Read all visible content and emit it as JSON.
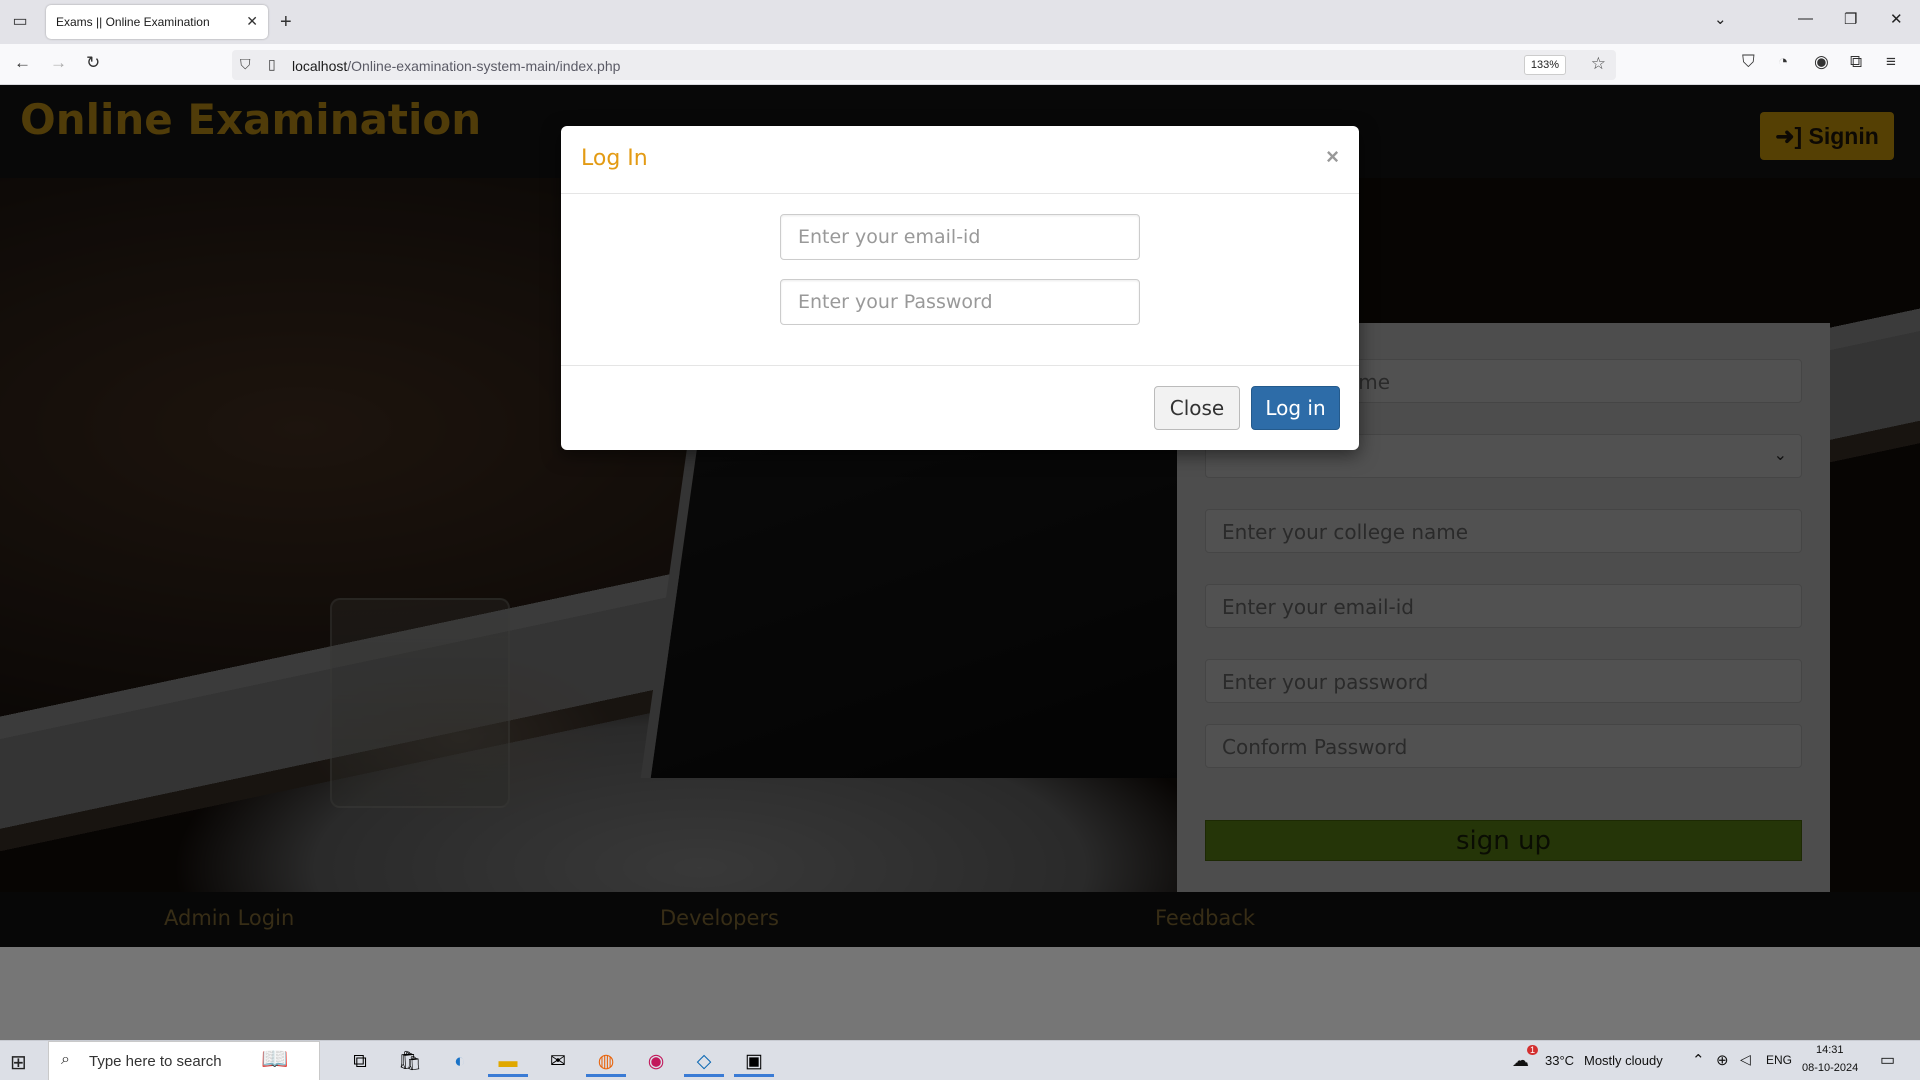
{
  "browser": {
    "tab_title": "Exams || Online Examination",
    "url_host": "localhost",
    "url_path": "/Online-examination-system-main/index.php",
    "zoom": "133%"
  },
  "site": {
    "logo": "Online Examination",
    "signin_label": "Signin"
  },
  "signup": {
    "name_placeholder": "Enter your name",
    "gender_value": "",
    "college_placeholder": "Enter your college name",
    "email_placeholder": "Enter your email-id",
    "password_placeholder": "Enter your password",
    "confirm_placeholder": "Conform Password",
    "submit_label": "sign up"
  },
  "footer": {
    "admin": "Admin Login",
    "developers": "Developers",
    "feedback": "Feedback"
  },
  "modal": {
    "title": "Log In",
    "close_x": "×",
    "email_placeholder": "Enter your email-id",
    "password_placeholder": "Enter your Password",
    "close_label": "Close",
    "login_label": "Log in"
  },
  "taskbar": {
    "search_placeholder": "Type here to search",
    "temperature": "33°C",
    "weather": "Mostly cloudy",
    "language": "ENG",
    "time": "14:31",
    "date": "08-10-2024",
    "weather_badge": "1"
  },
  "colors": {
    "logo": "#a17912",
    "signin": "#aa8009",
    "modal_title": "#e39b14",
    "login_btn": "#2d6ca8",
    "signup_btn": "#4b6b10"
  }
}
